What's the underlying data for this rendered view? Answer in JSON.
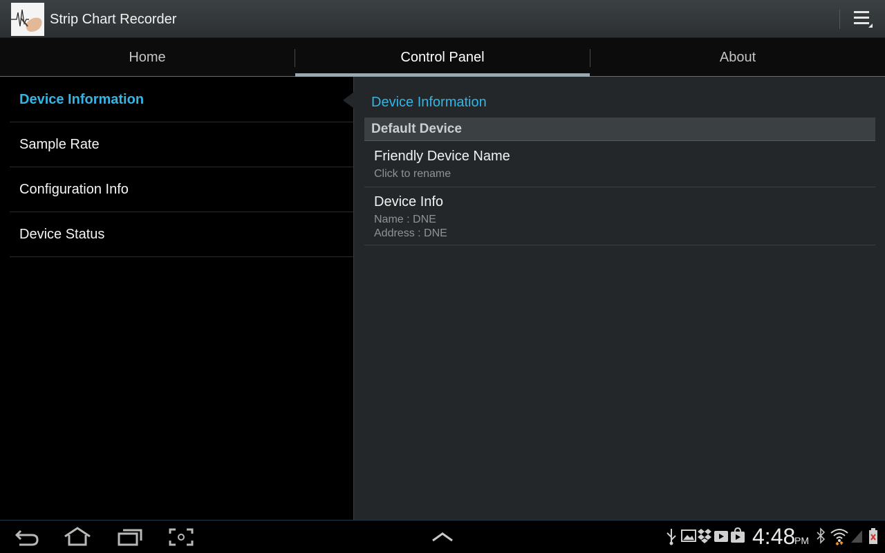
{
  "app": {
    "title": "Strip Chart Recorder"
  },
  "tabs": [
    {
      "label": "Home",
      "selected": false
    },
    {
      "label": "Control Panel",
      "selected": true
    },
    {
      "label": "About",
      "selected": false
    }
  ],
  "headers": [
    {
      "label": "Device Information",
      "active": true
    },
    {
      "label": "Sample Rate",
      "active": false
    },
    {
      "label": "Configuration Info",
      "active": false
    },
    {
      "label": "Device Status",
      "active": false
    }
  ],
  "detail": {
    "breadcrumb": "Device Information",
    "category": "Default Device",
    "prefs": [
      {
        "title": "Friendly Device Name",
        "summary": [
          "Click to rename"
        ]
      },
      {
        "title": "Device Info",
        "summary": [
          "Name : DNE",
          "Address : DNE"
        ]
      }
    ]
  },
  "status": {
    "time": "4:48",
    "ampm": "PM"
  },
  "icons": {
    "overflow": "overflow-menu-icon",
    "nav": [
      "back-icon",
      "home-icon",
      "recent-apps-icon",
      "screenshot-icon"
    ],
    "up": "chevron-up-icon",
    "status": [
      "usb-icon",
      "gallery-icon",
      "dropbox-icon",
      "play-icon",
      "store-icon",
      "play-store-icon",
      "bluetooth-icon",
      "wifi-icon",
      "signal-icon",
      "battery-icon"
    ]
  },
  "colors": {
    "accent": "#33b5e5",
    "indicator": "#9aa9b0"
  }
}
